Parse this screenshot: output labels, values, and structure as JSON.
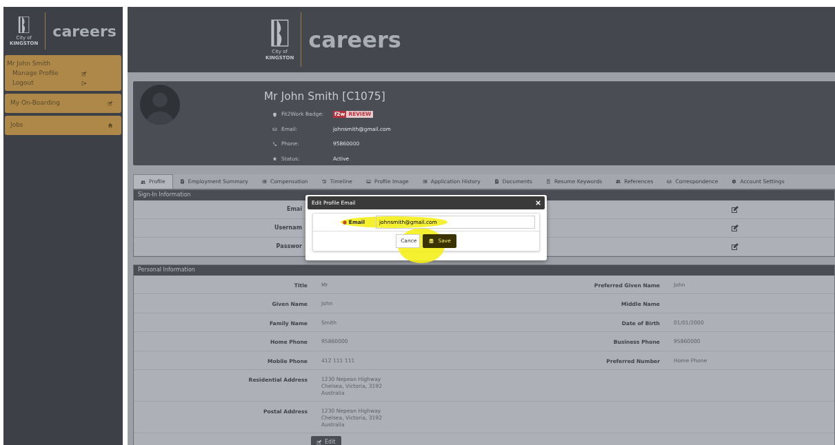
{
  "sidebar_brand": {
    "caption_small": "City of",
    "caption": "KINGSTON",
    "title": "careers"
  },
  "header_brand": {
    "caption_small": "City of",
    "caption": "KINGSTON",
    "title": "careers"
  },
  "sidebar": {
    "user": {
      "name": "Mr John Smith",
      "items": [
        {
          "label": "Manage Profile",
          "kind": "edit"
        },
        {
          "label": "Logout",
          "kind": "logout"
        }
      ]
    },
    "items": [
      {
        "label": "My On-Boarding",
        "kind": "edit"
      },
      {
        "label": "Jobs",
        "kind": "home"
      }
    ]
  },
  "profile": {
    "name": "Mr John Smith [C1075]",
    "fields": [
      {
        "label": "Fit2Work Badge:",
        "kind": "shield",
        "badge": {
          "logo": "f2w",
          "text": "REVIEW"
        }
      },
      {
        "label": "Email:",
        "kind": "envelope",
        "value": "johnsmith@gmail.com"
      },
      {
        "label": "Phone:",
        "kind": "phone",
        "value": "95860000"
      },
      {
        "label": "Status:",
        "kind": "star",
        "value": "Active"
      }
    ]
  },
  "tabs": [
    {
      "label": "Profile",
      "kind": "users",
      "selected": true
    },
    {
      "label": "Employment Summary",
      "kind": "doc",
      "selected": false
    },
    {
      "label": "Compensation",
      "kind": "list",
      "selected": false
    },
    {
      "label": "Timeline",
      "kind": "history",
      "selected": false
    },
    {
      "label": "Profile Image",
      "kind": "image",
      "selected": false
    },
    {
      "label": "Application History",
      "kind": "list",
      "selected": false
    },
    {
      "label": "Documents",
      "kind": "doc",
      "selected": false
    },
    {
      "label": "Resume Keywords",
      "kind": "book",
      "selected": false
    },
    {
      "label": "References",
      "kind": "users",
      "selected": false
    },
    {
      "label": "Correspondence",
      "kind": "envelope",
      "selected": false
    },
    {
      "label": "Account Settings",
      "kind": "gear",
      "selected": false
    }
  ],
  "sign_in": {
    "heading": "Sign-In Information",
    "rows": [
      {
        "label": "Emai"
      },
      {
        "label": "Usernam"
      },
      {
        "label": "Passwor"
      }
    ]
  },
  "modal": {
    "title": "Edit Profile Email",
    "field": {
      "label": "Email",
      "required": true,
      "value": "johnsmith@gmail.com"
    },
    "buttons": [
      {
        "label": "Cance",
        "kind": "default"
      },
      {
        "label": "Save",
        "kind": "primary"
      }
    ]
  },
  "personal": {
    "heading": "Personal Information",
    "rows": [
      {
        "left": {
          "label": "Title",
          "value": [
            "Mr"
          ]
        },
        "right": {
          "label": "Preferred Given Name",
          "value": [
            "John"
          ]
        }
      },
      {
        "left": {
          "label": "Given Name",
          "value": [
            "John"
          ]
        },
        "right": {
          "label": "Middle Name"
        }
      },
      {
        "left": {
          "label": "Family Name",
          "value": [
            "Smith"
          ]
        },
        "right": {
          "label": "Date of Birth",
          "value": [
            "01/01/2000"
          ]
        }
      },
      {
        "left": {
          "label": "Home Phone",
          "value": [
            "95860000"
          ]
        },
        "right": {
          "label": "Business Phone",
          "value": [
            "95860000"
          ]
        }
      },
      {
        "left": {
          "label": "Mobile Phone",
          "value": [
            "412 111 111"
          ]
        },
        "right": {
          "label": "Preferred Number",
          "value": [
            "Home Phone"
          ]
        }
      },
      {
        "left": {
          "label": "Residential Address",
          "value": [
            "1230 Nepean Highway",
            "Chelsea, Victoria, 3192",
            "Australia"
          ]
        }
      },
      {
        "left": {
          "label": "Postal Address",
          "value": [
            "1230 Nepean Highway",
            "Chelsea, Victoria, 3192",
            "Australia"
          ]
        }
      }
    ],
    "edit_button": "Edit"
  }
}
